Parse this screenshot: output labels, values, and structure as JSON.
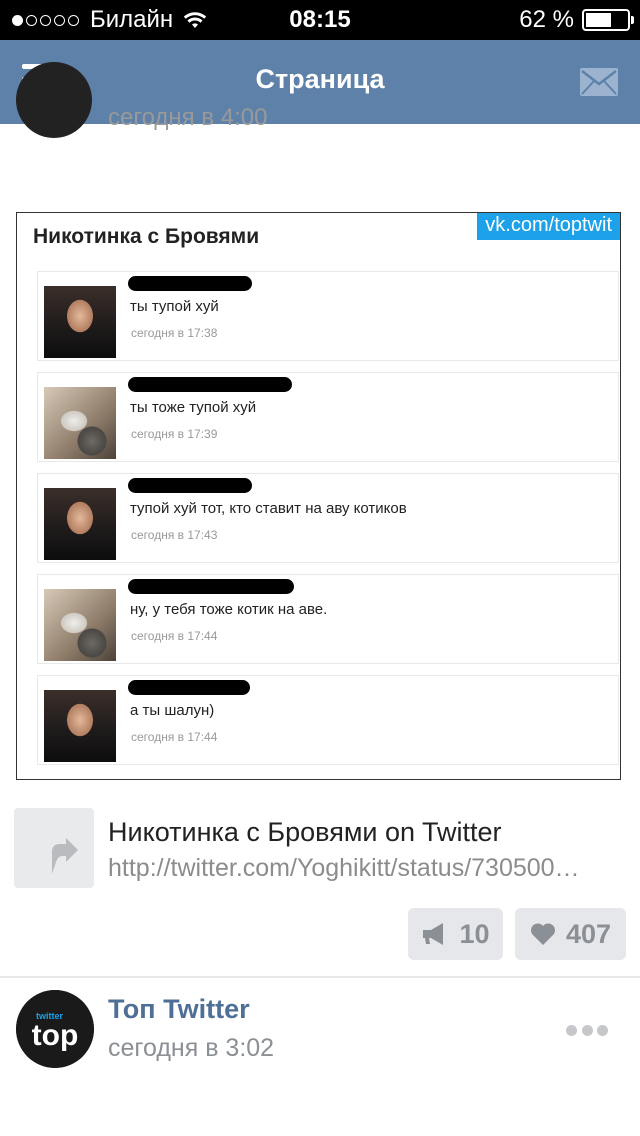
{
  "status_bar": {
    "carrier": "Билайн",
    "time": "08:15",
    "battery": "62 %",
    "battery_level": 0.62
  },
  "navbar": {
    "title": "Страница",
    "menu_icon": "hamburger-menu-icon",
    "mail_icon": "envelope-icon"
  },
  "previous_post": {
    "time": "сегодня в 4:00"
  },
  "post": {
    "screenshot": {
      "title": "Никотинка с Бровями",
      "watermark": "vk.com/toptwit",
      "messages": [
        {
          "avatar": "man",
          "text": "ты тупой хуй",
          "time": "сегодня в 17:38"
        },
        {
          "avatar": "cat",
          "text": "ты тоже тупой хуй",
          "time": "сегодня в 17:39"
        },
        {
          "avatar": "man",
          "text": "тупой хуй тот, кто ставит на аву котиков",
          "time": "сегодня в 17:43"
        },
        {
          "avatar": "cat",
          "text": "ну, у тебя тоже котик на аве.",
          "time": "сегодня в 17:44"
        },
        {
          "avatar": "man",
          "text": "а ты шалун)",
          "time": "сегодня в 17:44"
        }
      ]
    },
    "link": {
      "title": "Никотинка с Бровями on Twitter",
      "url": "http://twitter.com/Yoghikitt/status/730500…"
    },
    "actions": {
      "reposts": "10",
      "likes": "407"
    }
  },
  "next_post": {
    "author": "Топ Twitter",
    "time": "сегодня в 3:02",
    "avatar_small_text": "twitter",
    "avatar_big_text": "top"
  }
}
